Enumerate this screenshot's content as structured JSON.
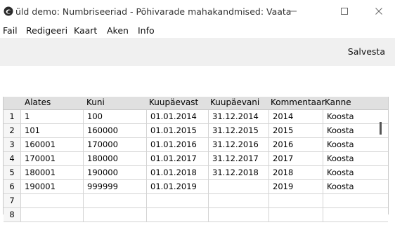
{
  "window": {
    "title": "üld demo: Numbriseeriad - Põhivarade mahakandmised: Vaata",
    "app_icon": "app-logo-icon"
  },
  "menu": [
    "Fail",
    "Redigeeri",
    "Kaart",
    "Aken",
    "Info"
  ],
  "toolbar": {
    "save_label": "Salvesta"
  },
  "table": {
    "columns": [
      "Alates",
      "Kuni",
      "Kuupäevast",
      "Kuupäevani",
      "Kommentaar",
      "Kanne"
    ],
    "rows": [
      {
        "num": "1",
        "alates": "1",
        "kuni": "100",
        "kuupaevast": "01.01.2014",
        "kuupaevani": "31.12.2014",
        "kommentaar": "2014",
        "kanne": "Koosta"
      },
      {
        "num": "2",
        "alates": "101",
        "kuni": "160000",
        "kuupaevast": "01.01.2015",
        "kuupaevani": "31.12.2015",
        "kommentaar": "2015",
        "kanne": "Koosta"
      },
      {
        "num": "3",
        "alates": "160001",
        "kuni": "170000",
        "kuupaevast": "01.01.2016",
        "kuupaevani": "31.12.2016",
        "kommentaar": "2016",
        "kanne": "Koosta"
      },
      {
        "num": "4",
        "alates": "170001",
        "kuni": "180000",
        "kuupaevast": "01.01.2017",
        "kuupaevani": "31.12.2017",
        "kommentaar": "2017",
        "kanne": "Koosta"
      },
      {
        "num": "5",
        "alates": "180001",
        "kuni": "190000",
        "kuupaevast": "01.01.2018",
        "kuupaevani": "31.12.2018",
        "kommentaar": "2018",
        "kanne": "Koosta"
      },
      {
        "num": "6",
        "alates": "190001",
        "kuni": "999999",
        "kuupaevast": "01.01.2019",
        "kuupaevani": "",
        "kommentaar": "2019",
        "kanne": "Koosta"
      },
      {
        "num": "7",
        "alates": "",
        "kuni": "",
        "kuupaevast": "",
        "kuupaevani": "",
        "kommentaar": "",
        "kanne": ""
      },
      {
        "num": "8",
        "alates": "",
        "kuni": "",
        "kuupaevast": "",
        "kuupaevani": "",
        "kommentaar": "",
        "kanne": ""
      }
    ]
  },
  "colors": {
    "header_bg": "#e0e0e0",
    "toolbar_bg": "#f0f0f0",
    "grid_line": "#d4d4d4"
  }
}
